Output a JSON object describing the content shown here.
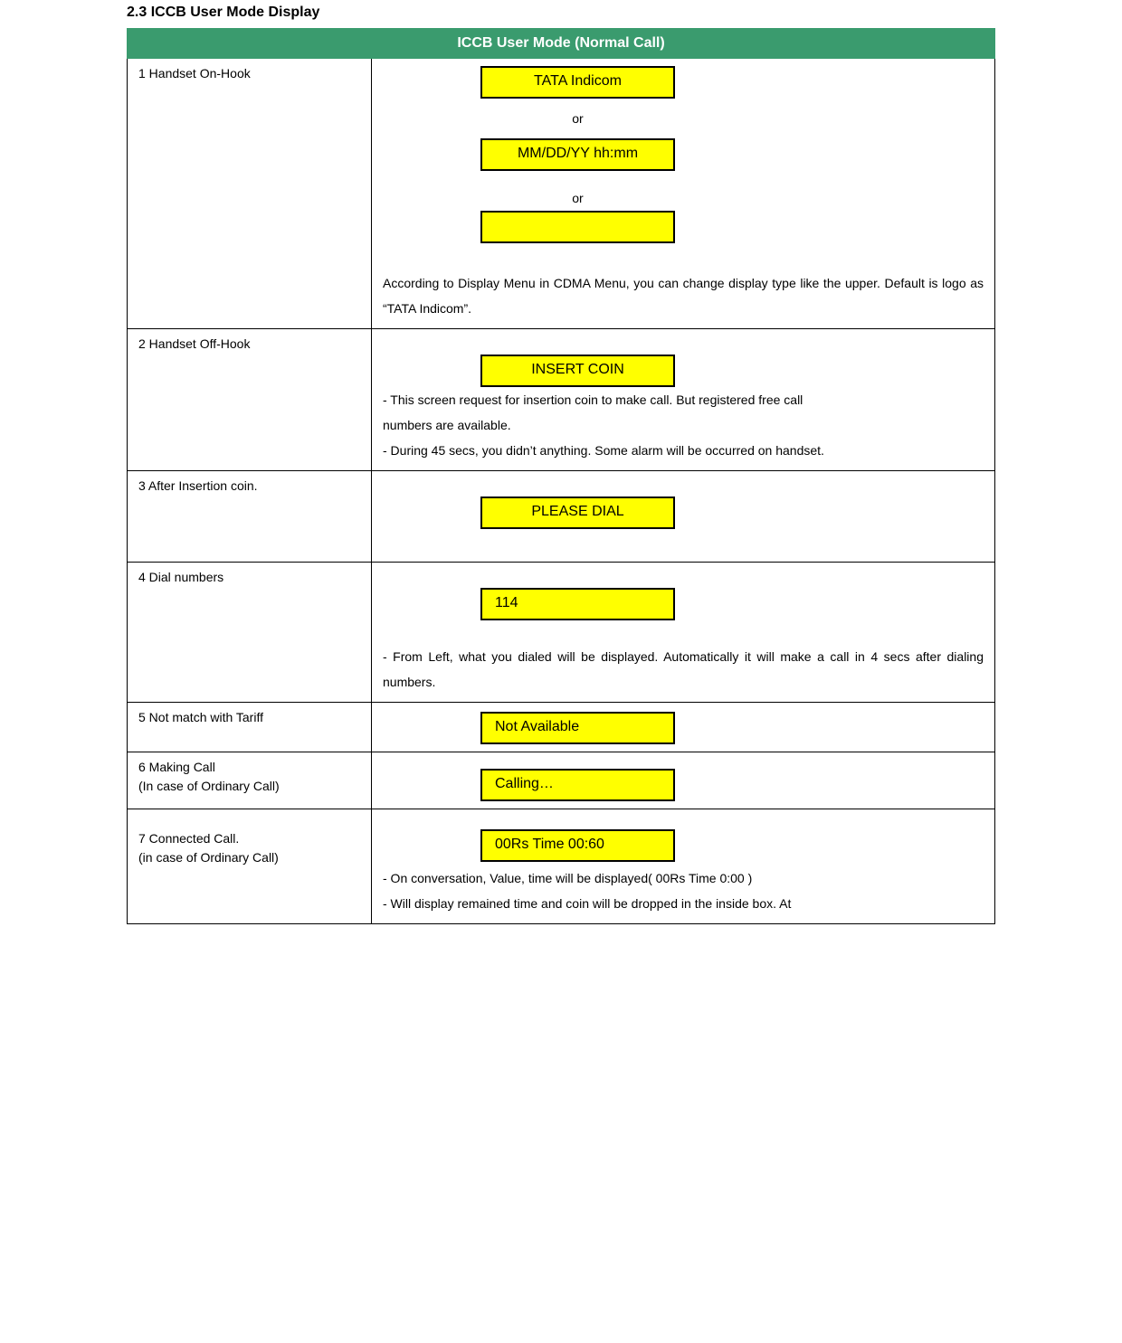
{
  "heading": "2.3 ICCB User Mode Display",
  "tableTitle": "ICCB User Mode (Normal Call)",
  "rows": {
    "r1": {
      "label": "1 Handset On-Hook",
      "box1": "TATA Indicom",
      "or1": "or",
      "box2": "MM/DD/YY hh:mm",
      "or2": "or",
      "box3": "",
      "desc1": "According to Display Menu in CDMA Menu, you can change display type like the upper. Default is logo as “TATA Indicom”."
    },
    "r2": {
      "label": "2 Handset Off-Hook",
      "box": "INSERT COIN",
      "b1": "- This screen request for insertion coin to make call. But registered free call",
      "b1b": " numbers are available.",
      "b2": "- During 45 secs, you didn’t anything. Some alarm will be occurred on handset."
    },
    "r3": {
      "label": "3 After Insertion coin.",
      "box": "PLEASE DIAL"
    },
    "r4": {
      "label": "4 Dial numbers",
      "box": "114",
      "desc": "- From Left, what you dialed will be displayed. Automatically it will make a call in 4 secs after dialing numbers."
    },
    "r5": {
      "label": "5 Not match with Tariff",
      "box": "Not Available"
    },
    "r6": {
      "label": "6 Making Call",
      "sub": " (In case of Ordinary Call)",
      "box": "Calling…"
    },
    "r7": {
      "label": "7 Connected Call.",
      "sub": "  (in case of Ordinary Call)",
      "box": "00Rs Time 00:60",
      "b1": "- On conversation, Value, time will be displayed( 00Rs Time 0:00 )",
      "b2": "- Will display remained time and coin will be dropped in the inside box. At"
    }
  }
}
